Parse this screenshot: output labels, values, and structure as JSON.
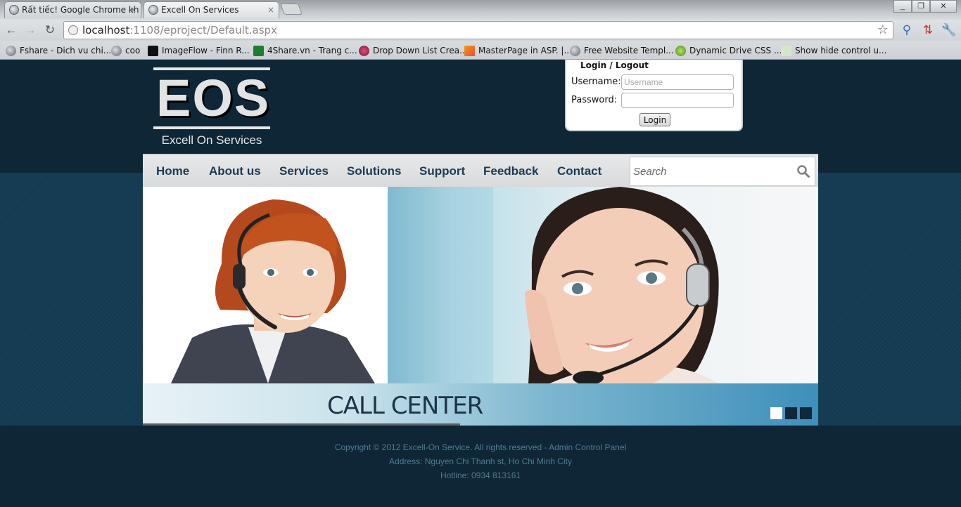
{
  "browser": {
    "tabs": [
      {
        "title": "Rất tiếc! Google Chrome kh",
        "active": false
      },
      {
        "title": "Excell On Services",
        "active": true
      }
    ],
    "url_host": "localhost",
    "url_rest": ":1108/eproject/Default.aspx",
    "bookmarks": [
      "Fshare - Dich vu chi...",
      "coo",
      "ImageFlow - Finn R...",
      "4Share.vn - Trang c...",
      "Drop Down List Crea...",
      "MasterPage in ASP. |...",
      "Free Website Templ...",
      "Dynamic Drive CSS ...",
      "Show hide control u..."
    ],
    "window_controls": {
      "minimize": "_",
      "restore": "❐",
      "close": "✕"
    }
  },
  "site": {
    "logo_text": "EOS",
    "logo_tagline": "Excell On Services",
    "login": {
      "title": "Login / Logout",
      "username_label": "Username:",
      "username_placeholder": "Username",
      "password_label": "Password:",
      "button_label": "Login"
    },
    "nav": [
      "Home",
      "About us",
      "Services",
      "Solutions",
      "Support",
      "Feedback",
      "Contact"
    ],
    "search_placeholder": "Search",
    "banner_caption": "CALL CENTER",
    "slider_dots": 3,
    "slider_active_index": 0,
    "footer": {
      "copyright": "Copyright © 2012 Excell-On Service. All rights reserved - Admin Control Panel",
      "address": "Address: Nguyen Chi Thanh st, Ho Chi Minh City",
      "hotline": "Hotline: 0934 813161"
    }
  },
  "colors": {
    "header_bg": "#0e2636",
    "nav_text": "#1b3a52",
    "caption_text": "#1c3447",
    "footer_text": "#4f7b93"
  }
}
